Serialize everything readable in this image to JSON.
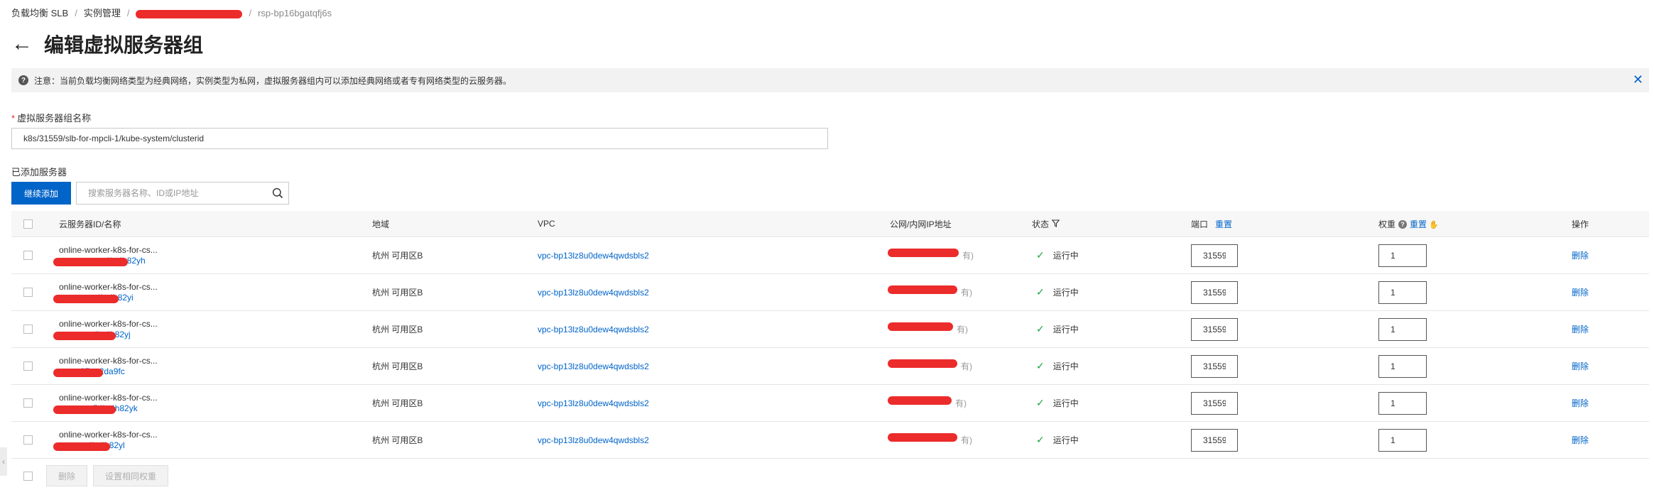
{
  "breadcrumb": [
    "负载均衡 SLB",
    "实例管理",
    "rsp-bp16bgatqfj6s"
  ],
  "title": "编辑虚拟服务器组",
  "notice": "注意：当前负载均衡网络类型为经典网络，实例类型为私网，虚拟服务器组内可以添加经典网络或者专有网络类型的云服务器。",
  "form": {
    "name_label": "虚拟服务器组名称",
    "name_value": "k8s/31559/slb-for-mpcli-1/kube-system/clusterid"
  },
  "added_label": "已添加服务器",
  "continue_label": "继续添加",
  "search_placeholder": "搜索服务器名称、ID或IP地址",
  "columns": {
    "id": "云服务器ID/名称",
    "region": "地域",
    "vpc": "VPC",
    "ip": "公网/内网IP地址",
    "status": "状态",
    "port": "端口",
    "port_reset": "重置",
    "weight": "权重",
    "weight_reset": "重置",
    "op": "操作"
  },
  "rows": [
    {
      "name": "online-worker-k8s-for-cs...",
      "id": "i-bp1...4br4h82yh",
      "id_visible": "4br4h82yh",
      "region": "杭州 可用区B",
      "vpc": "vpc-bp13lz8u0dew4qwdsbls2",
      "ip_suffix": "有)",
      "status": "运行中",
      "port": "31559",
      "weight": "1",
      "op": "删除"
    },
    {
      "name": "online-worker-k8s-for-cs...",
      "id": "i-bp1...4br4h82yi",
      "id_visible": "4br4h82yi",
      "region": "杭州 可用区B",
      "vpc": "vpc-bp13lz8u0dew4qwdsbls2",
      "ip_suffix": "有)",
      "status": "运行中",
      "port": "31559",
      "weight": "1",
      "op": "删除"
    },
    {
      "name": "online-worker-k8s-for-cs...",
      "id": "i-bp1...4br4h82yj",
      "id_visible": "4br4h82yj",
      "region": "杭州 可用区B",
      "vpc": "vpc-bp13lz8u0dew4qwdsbls2",
      "ip_suffix": "有)",
      "status": "运行中",
      "port": "31559",
      "weight": "1",
      "op": "删除"
    },
    {
      "name": "online-worker-k8s-for-cs...",
      "id": "i-bp1...05ga2da9fc",
      "id_visible": "05ga2da9fc",
      "region": "杭州 可用区B",
      "vpc": "vpc-bp13lz8u0dew4qwdsbls2",
      "ip_suffix": "有)",
      "status": "运行中",
      "port": "31559",
      "weight": "1",
      "op": "删除"
    },
    {
      "name": "online-worker-k8s-for-cs...",
      "id": "i-bp1...54br4h82yk",
      "id_visible": "54br4h82yk",
      "region": "杭州 可用区B",
      "vpc": "vpc-bp13lz8u0dew4qwdsbls2",
      "ip_suffix": "有)",
      "status": "运行中",
      "port": "31559",
      "weight": "1",
      "op": "删除"
    },
    {
      "name": "online-worker-k8s-for-cs...",
      "id": "i-bp1...4br4h82yl",
      "id_visible": "4br4h82yl",
      "region": "杭州 可用区B",
      "vpc": "vpc-bp13lz8u0dew4qwdsbls2",
      "ip_suffix": "有)",
      "status": "运行中",
      "port": "31559",
      "weight": "1",
      "op": "删除"
    }
  ],
  "footer": {
    "delete_label": "删除",
    "set_weight_label": "设置相同权重"
  },
  "colors": {
    "primary": "#0064c8",
    "redaction": "#ec2b2b",
    "success": "#1aa341"
  }
}
